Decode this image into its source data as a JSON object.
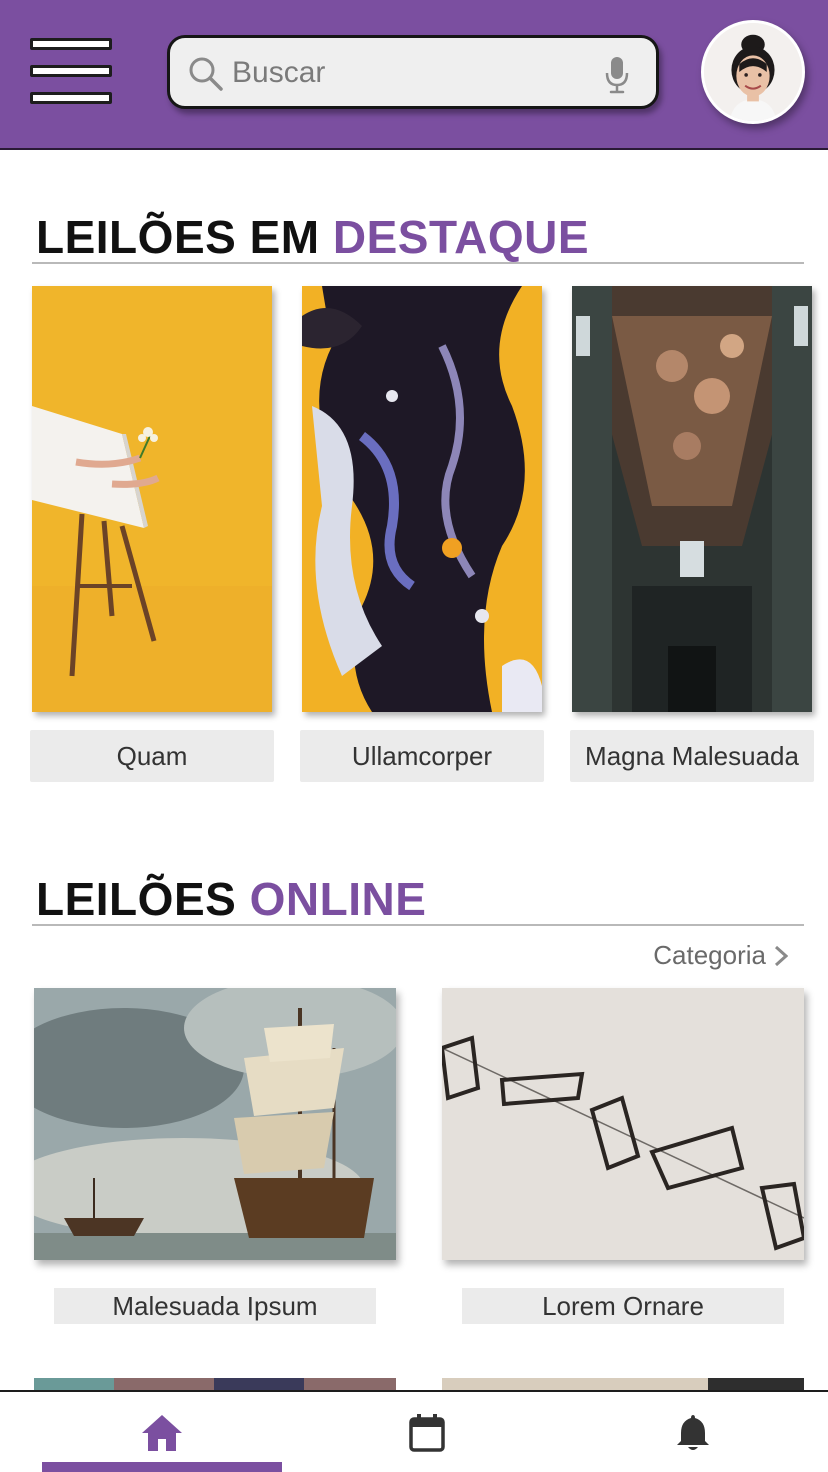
{
  "header": {
    "search": {
      "placeholder": "Buscar",
      "value": ""
    },
    "icons": {
      "menu": "hamburger-menu-icon",
      "search": "magnifier-icon",
      "mic": "microphone-icon",
      "avatar": "user-avatar"
    }
  },
  "featured": {
    "title_plain": "LEILÕES EM",
    "title_accent": "DESTAQUE",
    "items": [
      {
        "label": "Quam"
      },
      {
        "label": "Ullamcorper"
      },
      {
        "label": "Magna Malesuada"
      }
    ]
  },
  "online": {
    "title_plain": "LEILÕES",
    "title_accent": "ONLINE",
    "category_label": "Categoria",
    "items": [
      {
        "label": "Malesuada Ipsum"
      },
      {
        "label": "Lorem Ornare"
      }
    ]
  },
  "bottom_nav": {
    "items": [
      {
        "icon": "home-icon",
        "active": true
      },
      {
        "icon": "calendar-icon",
        "active": false
      },
      {
        "icon": "bell-icon",
        "active": false
      }
    ]
  },
  "colors": {
    "brand": "#7b4fa0",
    "label_bg": "#ebebeb",
    "text": "#111111"
  }
}
